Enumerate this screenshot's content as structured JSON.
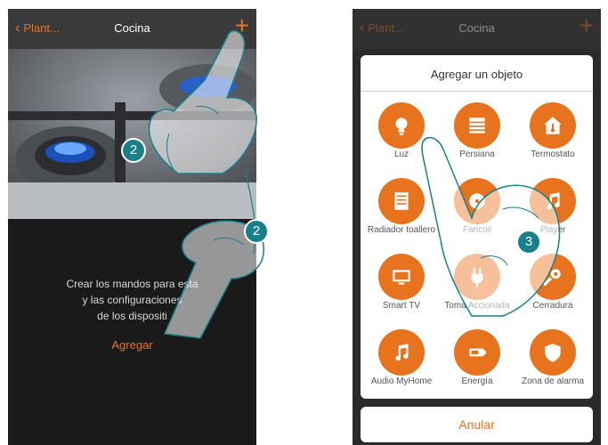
{
  "left_screen": {
    "back_label": "Plant...",
    "title": "Cocina",
    "add_icon": "plus-icon",
    "info_lines": [
      "Crear los mandos para esta",
      "y las configuraciones",
      "de los dispositi"
    ],
    "add_link": "Agregar"
  },
  "right_screen": {
    "back_label": "Plant...",
    "title": "Cocina",
    "modal_title": "Agregar un objeto",
    "objects": [
      {
        "label": "Luz",
        "icon": "lightbulb-icon"
      },
      {
        "label": "Persiana",
        "icon": "shutter-icon"
      },
      {
        "label": "Termostato",
        "icon": "thermostat-icon"
      },
      {
        "label": "Radiador toallero",
        "icon": "towel-radiator-icon"
      },
      {
        "label": "Fancoil",
        "icon": "fancoil-icon"
      },
      {
        "label": "Player",
        "icon": "music-note-icon"
      },
      {
        "label": "Smart TV",
        "icon": "tv-icon"
      },
      {
        "label": "Toma Accionada",
        "icon": "plug-icon"
      },
      {
        "label": "Cerradura",
        "icon": "key-icon"
      },
      {
        "label": "Audio MyHome",
        "icon": "music-note-icon"
      },
      {
        "label": "Energía",
        "icon": "battery-icon"
      },
      {
        "label": "Zona de alarma",
        "icon": "shield-icon"
      }
    ],
    "cancel_label": "Anular"
  },
  "step_badges": [
    "2",
    "2",
    "3"
  ],
  "colors": {
    "accent": "#e8731f",
    "badge": "#1a7f8a"
  }
}
